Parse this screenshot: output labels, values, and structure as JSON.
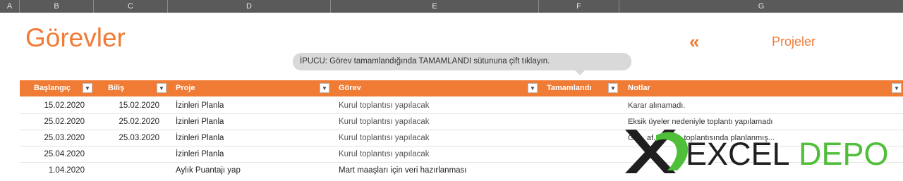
{
  "column_headers": [
    "A",
    "B",
    "C",
    "D",
    "E",
    "F",
    "G"
  ],
  "title": "Görevler",
  "nav": {
    "arrow": "«",
    "link": "Projeler"
  },
  "tip": "İPUCU: Görev tamamlandığında TAMAMLANDI sütununa çift tıklayın.",
  "table": {
    "headers": [
      "Başlangıç",
      "Biliş",
      "Proje",
      "Görev",
      "Tamamlandı",
      "Notlar"
    ],
    "rows": [
      [
        "15.02.2020",
        "15.02.2020",
        "İzinleri Planla",
        "Kurul toplantısı yapılacak",
        "",
        "Karar alınamadı."
      ],
      [
        "25.02.2020",
        "25.02.2020",
        "İzinleri Planla",
        "Kurul toplantısı yapılacak",
        "",
        "Eksik üyeler nedeniyle toplantı yapılamadı"
      ],
      [
        "25.03.2020",
        "25.03.2020",
        "İzinleri Planla",
        "Kurul toplantısı yapılacak",
        "",
        "Gü... af... Nisan toplantısında planlanmış..."
      ],
      [
        "25.04.2020",
        "",
        "İzinleri Planla",
        "Kurul toplantısı yapılacak",
        "",
        ""
      ],
      [
        "1.04.2020",
        "",
        "Aylık Puantajı yap",
        "Mart maaşları için veri hazırlanması",
        "",
        ""
      ]
    ]
  },
  "logo": {
    "left": "EXCEL",
    "right": "DEPO"
  },
  "colors": {
    "accent": "#f07b35",
    "header_gray": "#5a5a5a",
    "logo_green": "#4fbf3a",
    "logo_dark": "#1f1f1f"
  }
}
